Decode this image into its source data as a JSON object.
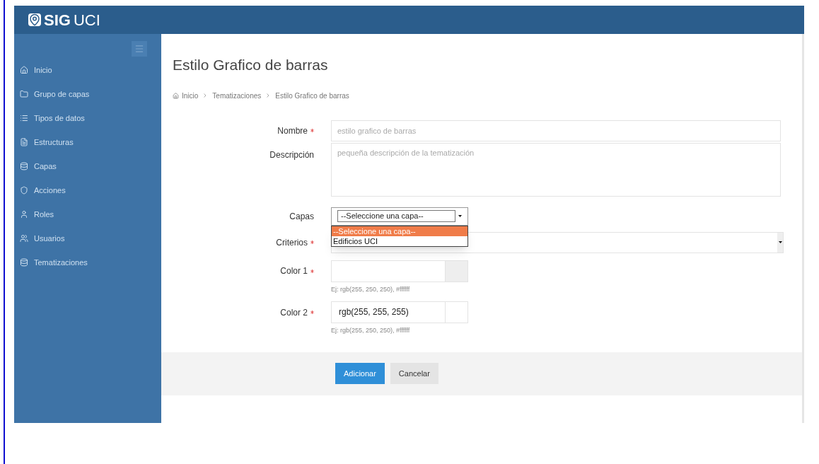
{
  "header": {
    "logo_bold": "SIG",
    "logo_light": "UCI"
  },
  "sidebar": {
    "items": [
      {
        "label": "Inicio",
        "kind": "home"
      },
      {
        "label": "Grupo de capas",
        "kind": "folder"
      },
      {
        "label": "Tipos de datos",
        "kind": "list"
      },
      {
        "label": "Estructuras",
        "kind": "doc"
      },
      {
        "label": "Capas",
        "kind": "db"
      },
      {
        "label": "Acciones",
        "kind": "shield"
      },
      {
        "label": "Roles",
        "kind": "user"
      },
      {
        "label": "Usuarios",
        "kind": "users"
      },
      {
        "label": "Tematizaciones",
        "kind": "db"
      }
    ]
  },
  "page": {
    "title": "Estilo Grafico de barras",
    "breadcrumb": [
      "Inicio",
      "Tematizaciones",
      "Estilo Grafico de barras"
    ]
  },
  "form": {
    "nombre": {
      "label": "Nombre",
      "required": true,
      "placeholder": "estilo grafico de barras"
    },
    "descripcion": {
      "label": "Descripción",
      "required": false,
      "placeholder": "pequeña descripción de la tematización"
    },
    "capas": {
      "label": "Capas",
      "required": false,
      "value": "--Seleccione una capa--",
      "expanded": true,
      "options": [
        {
          "label": "--Seleccione una capa--",
          "selected": true
        },
        {
          "label": "Edificios UCI",
          "selected": false
        }
      ]
    },
    "criterios": {
      "label": "Criterios",
      "required": true
    },
    "colors": [
      {
        "label": "Color 1",
        "required": true,
        "color": "#eeeeee",
        "hint": "Ej: rgb(255, 250, 250), #ffffff"
      },
      {
        "label": "Color 2",
        "required": true,
        "value": "rgb(255, 255, 255)",
        "color": "#ffffff",
        "hint": "Ej: rgb(255, 250, 250), #ffffff"
      }
    ],
    "buttons": [
      {
        "label": "Adicionar",
        "kind": "primary"
      },
      {
        "label": "Cancelar",
        "kind": "default"
      }
    ]
  }
}
